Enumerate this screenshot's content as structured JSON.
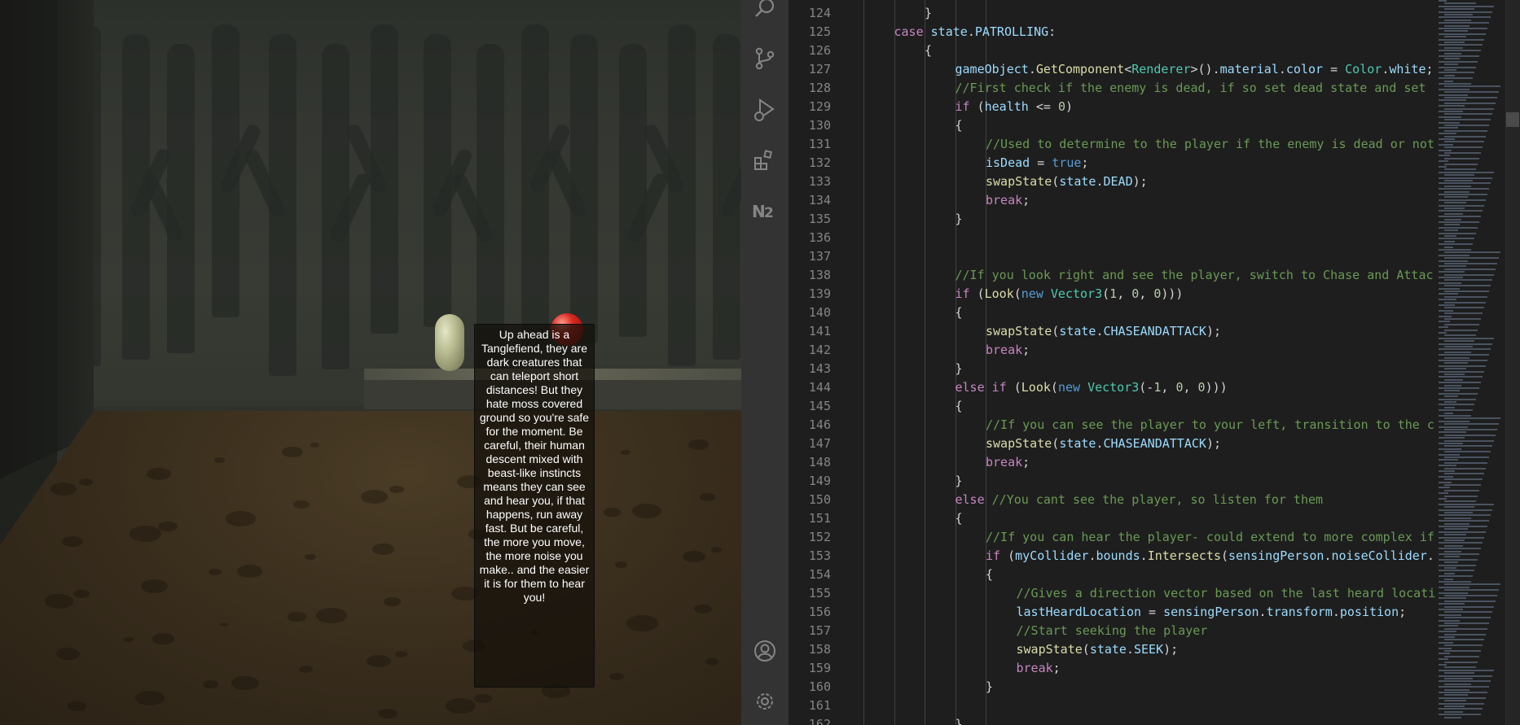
{
  "game": {
    "dialog_text": "Up ahead is a\nTanglefiend,  they are\ndark creatures that\ncan teleport short\ndistances! But they\nhate moss covered\nground so you're safe\nfor the moment. Be\ncareful, their human\ndescent mixed with\nbeast-like instincts\nmeans they can see\nand hear you, if that\nhappens, run away\nfast. But be careful,\nthe more you move,\nthe more noise you\nmake.. and the easier\nit is for them to hear\nyou!"
  },
  "activity_bar": {
    "icons": [
      "search-icon",
      "source-control-icon",
      "run-debug-icon",
      "extensions-icon",
      "nx-console-icon",
      "account-icon",
      "settings-gear-icon"
    ]
  },
  "editor": {
    "lines": [
      {
        "n": "124",
        "indent": 2,
        "tokens": [
          [
            "pl",
            "}"
          ]
        ]
      },
      {
        "n": "125",
        "indent": 1,
        "tokens": [
          [
            "kw",
            "case "
          ],
          [
            "id",
            "state"
          ],
          [
            "pl",
            "."
          ],
          [
            "id",
            "PATROLLING"
          ],
          [
            "pl",
            ":"
          ]
        ]
      },
      {
        "n": "126",
        "indent": 2,
        "tokens": [
          [
            "pl",
            "{"
          ]
        ]
      },
      {
        "n": "127",
        "indent": 3,
        "tokens": [
          [
            "id",
            "gameObject"
          ],
          [
            "pl",
            "."
          ],
          [
            "fn",
            "GetComponent"
          ],
          [
            "pl",
            "<"
          ],
          [
            "type",
            "Renderer"
          ],
          [
            "pl",
            ">()."
          ],
          [
            "id",
            "material"
          ],
          [
            "pl",
            "."
          ],
          [
            "id",
            "color"
          ],
          [
            "pl",
            " = "
          ],
          [
            "type",
            "Color"
          ],
          [
            "pl",
            "."
          ],
          [
            "id",
            "white"
          ],
          [
            "pl",
            ";"
          ]
        ]
      },
      {
        "n": "128",
        "indent": 3,
        "tokens": [
          [
            "cm",
            "//First check if the enemy is dead, if so set dead state and set"
          ]
        ]
      },
      {
        "n": "129",
        "indent": 3,
        "tokens": [
          [
            "kw",
            "if"
          ],
          [
            "pl",
            " ("
          ],
          [
            "id",
            "health"
          ],
          [
            "pl",
            " <= "
          ],
          [
            "num",
            "0"
          ],
          [
            "pl",
            ")"
          ]
        ]
      },
      {
        "n": "130",
        "indent": 3,
        "tokens": [
          [
            "pl",
            "{"
          ]
        ]
      },
      {
        "n": "131",
        "indent": 4,
        "tokens": [
          [
            "cm",
            "//Used to determine to the player if the enemy is dead or not"
          ]
        ]
      },
      {
        "n": "132",
        "indent": 4,
        "tokens": [
          [
            "id",
            "isDead"
          ],
          [
            "pl",
            " = "
          ],
          [
            "kw2",
            "true"
          ],
          [
            "pl",
            ";"
          ]
        ]
      },
      {
        "n": "133",
        "indent": 4,
        "tokens": [
          [
            "fn",
            "swapState"
          ],
          [
            "pl",
            "("
          ],
          [
            "id",
            "state"
          ],
          [
            "pl",
            "."
          ],
          [
            "id",
            "DEAD"
          ],
          [
            "pl",
            ");"
          ]
        ]
      },
      {
        "n": "134",
        "indent": 4,
        "tokens": [
          [
            "kw",
            "break"
          ],
          [
            "pl",
            ";"
          ]
        ]
      },
      {
        "n": "135",
        "indent": 3,
        "tokens": [
          [
            "pl",
            "}"
          ]
        ]
      },
      {
        "n": "136",
        "indent": 0,
        "tokens": []
      },
      {
        "n": "137",
        "indent": 0,
        "tokens": []
      },
      {
        "n": "138",
        "indent": 3,
        "tokens": [
          [
            "cm",
            "//If you look right and see the player, switch to Chase and Attac"
          ]
        ]
      },
      {
        "n": "139",
        "indent": 3,
        "tokens": [
          [
            "kw",
            "if"
          ],
          [
            "pl",
            " ("
          ],
          [
            "fn",
            "Look"
          ],
          [
            "pl",
            "("
          ],
          [
            "kw2",
            "new"
          ],
          [
            "pl",
            " "
          ],
          [
            "type",
            "Vector3"
          ],
          [
            "pl",
            "("
          ],
          [
            "num",
            "1"
          ],
          [
            "pl",
            ", "
          ],
          [
            "num",
            "0"
          ],
          [
            "pl",
            ", "
          ],
          [
            "num",
            "0"
          ],
          [
            "pl",
            ")))"
          ]
        ]
      },
      {
        "n": "140",
        "indent": 3,
        "tokens": [
          [
            "pl",
            "{"
          ]
        ]
      },
      {
        "n": "141",
        "indent": 4,
        "tokens": [
          [
            "fn",
            "swapState"
          ],
          [
            "pl",
            "("
          ],
          [
            "id",
            "state"
          ],
          [
            "pl",
            "."
          ],
          [
            "id",
            "CHASEANDATTACK"
          ],
          [
            "pl",
            ");"
          ]
        ]
      },
      {
        "n": "142",
        "indent": 4,
        "tokens": [
          [
            "kw",
            "break"
          ],
          [
            "pl",
            ";"
          ]
        ]
      },
      {
        "n": "143",
        "indent": 3,
        "tokens": [
          [
            "pl",
            "}"
          ]
        ]
      },
      {
        "n": "144",
        "indent": 3,
        "tokens": [
          [
            "kw",
            "else if"
          ],
          [
            "pl",
            " ("
          ],
          [
            "fn",
            "Look"
          ],
          [
            "pl",
            "("
          ],
          [
            "kw2",
            "new"
          ],
          [
            "pl",
            " "
          ],
          [
            "type",
            "Vector3"
          ],
          [
            "pl",
            "(-"
          ],
          [
            "num",
            "1"
          ],
          [
            "pl",
            ", "
          ],
          [
            "num",
            "0"
          ],
          [
            "pl",
            ", "
          ],
          [
            "num",
            "0"
          ],
          [
            "pl",
            ")))"
          ]
        ]
      },
      {
        "n": "145",
        "indent": 3,
        "tokens": [
          [
            "pl",
            "{"
          ]
        ]
      },
      {
        "n": "146",
        "indent": 4,
        "tokens": [
          [
            "cm",
            "//If you can see the player to your left, transition to the c"
          ]
        ]
      },
      {
        "n": "147",
        "indent": 4,
        "tokens": [
          [
            "fn",
            "swapState"
          ],
          [
            "pl",
            "("
          ],
          [
            "id",
            "state"
          ],
          [
            "pl",
            "."
          ],
          [
            "id",
            "CHASEANDATTACK"
          ],
          [
            "pl",
            ");"
          ]
        ]
      },
      {
        "n": "148",
        "indent": 4,
        "tokens": [
          [
            "kw",
            "break"
          ],
          [
            "pl",
            ";"
          ]
        ]
      },
      {
        "n": "149",
        "indent": 3,
        "tokens": [
          [
            "pl",
            "}"
          ]
        ]
      },
      {
        "n": "150",
        "indent": 3,
        "tokens": [
          [
            "kw",
            "else"
          ],
          [
            "pl",
            " "
          ],
          [
            "cm",
            "//You cant see the player, so listen for them"
          ]
        ]
      },
      {
        "n": "151",
        "indent": 3,
        "tokens": [
          [
            "pl",
            "{"
          ]
        ]
      },
      {
        "n": "152",
        "indent": 4,
        "tokens": [
          [
            "cm",
            "//If you can hear the player- could extend to more complex if"
          ]
        ]
      },
      {
        "n": "153",
        "indent": 4,
        "tokens": [
          [
            "kw",
            "if"
          ],
          [
            "pl",
            " ("
          ],
          [
            "id",
            "myCollider"
          ],
          [
            "pl",
            "."
          ],
          [
            "id",
            "bounds"
          ],
          [
            "pl",
            "."
          ],
          [
            "fn",
            "Intersects"
          ],
          [
            "pl",
            "("
          ],
          [
            "id",
            "sensingPerson"
          ],
          [
            "pl",
            "."
          ],
          [
            "id",
            "noiseCollider"
          ],
          [
            "pl",
            "."
          ]
        ]
      },
      {
        "n": "154",
        "indent": 4,
        "tokens": [
          [
            "pl",
            "{"
          ]
        ]
      },
      {
        "n": "155",
        "indent": 5,
        "tokens": [
          [
            "cm",
            "//Gives a direction vector based on the last heard locati"
          ]
        ]
      },
      {
        "n": "156",
        "indent": 5,
        "tokens": [
          [
            "id",
            "lastHeardLocation"
          ],
          [
            "pl",
            " = "
          ],
          [
            "id",
            "sensingPerson"
          ],
          [
            "pl",
            "."
          ],
          [
            "id",
            "transform"
          ],
          [
            "pl",
            "."
          ],
          [
            "id",
            "position"
          ],
          [
            "pl",
            ";"
          ]
        ]
      },
      {
        "n": "157",
        "indent": 5,
        "tokens": [
          [
            "cm",
            "//Start seeking the player"
          ]
        ]
      },
      {
        "n": "158",
        "indent": 5,
        "tokens": [
          [
            "fn",
            "swapState"
          ],
          [
            "pl",
            "("
          ],
          [
            "id",
            "state"
          ],
          [
            "pl",
            "."
          ],
          [
            "id",
            "SEEK"
          ],
          [
            "pl",
            ");"
          ]
        ]
      },
      {
        "n": "159",
        "indent": 5,
        "tokens": [
          [
            "kw",
            "break"
          ],
          [
            "pl",
            ";"
          ]
        ]
      },
      {
        "n": "160",
        "indent": 4,
        "tokens": [
          [
            "pl",
            "}"
          ]
        ]
      },
      {
        "n": "161",
        "indent": 0,
        "tokens": []
      },
      {
        "n": "162",
        "indent": 3,
        "tokens": [
          [
            "pl",
            "}"
          ]
        ]
      }
    ]
  },
  "colors": {
    "keyword": "#c586c0",
    "type": "#4ec9b0",
    "identifier": "#9cdcfe",
    "function": "#dcdcaa",
    "comment": "#6a9955",
    "number": "#b5cea8",
    "keyword_blue": "#569cd6",
    "plain": "#d4d4d4"
  }
}
